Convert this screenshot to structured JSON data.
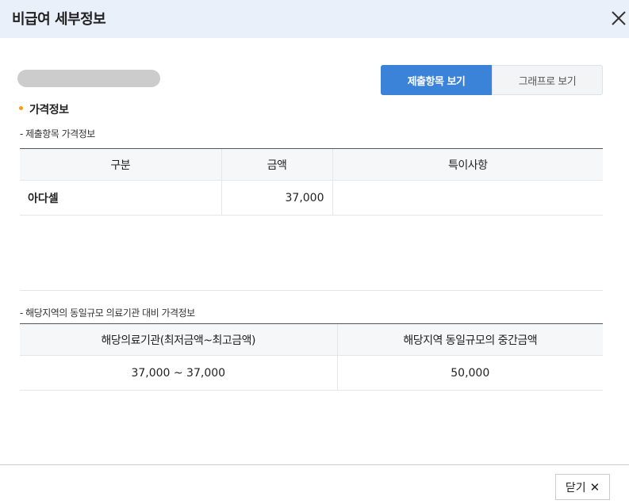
{
  "dialog": {
    "title": "비급여 세부정보"
  },
  "view_toggle": {
    "submitted_label": "제출항목 보기",
    "graph_label": "그래프로 보기"
  },
  "section": {
    "title": "가격정보"
  },
  "submitted_price": {
    "subtitle": "- 제출항목 가격정보",
    "headers": [
      "구분",
      "금액",
      "특이사항"
    ],
    "rows": [
      {
        "category": "아다셀",
        "amount": "37,000",
        "note": ""
      }
    ]
  },
  "regional_price": {
    "subtitle": "- 해당지역의 동일규모 의료기관 대비 가격정보",
    "headers": [
      "해당의료기관(최저금액~최고금액)",
      "해당지역 동일규모의 중간금액"
    ],
    "rows": [
      {
        "range": "37,000 ~ 37,000",
        "median": "50,000"
      }
    ]
  },
  "footer": {
    "close_label": "닫기",
    "close_glyph": "✕"
  },
  "colors": {
    "header_bg": "#eaf0fa",
    "accent_blue": "#3b82d9",
    "bullet_orange": "#f39c12"
  }
}
